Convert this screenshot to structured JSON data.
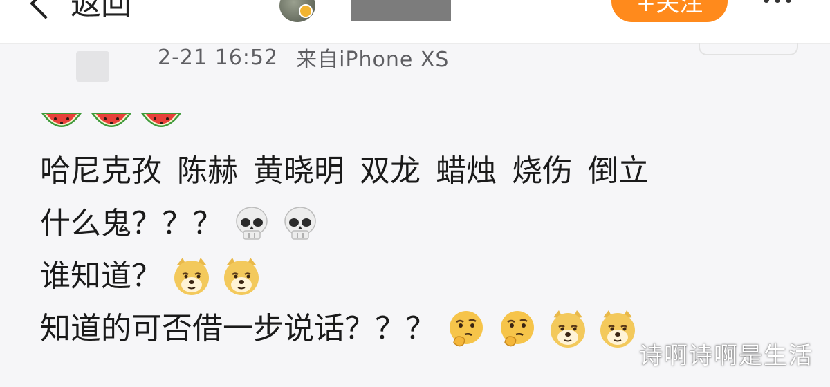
{
  "nav": {
    "back_label": "返回",
    "follow_label": "+关注"
  },
  "post": {
    "time": "2-21 16:52",
    "source": "来自iPhone XS",
    "lines": [
      {
        "words": [
          "哈尼克孜",
          "陈赫",
          "黄晓明",
          "双龙",
          "蜡烛",
          "烧伤",
          "倒立"
        ]
      },
      {
        "text": "什么鬼？？？"
      },
      {
        "text": "谁知道？"
      },
      {
        "text": "知道的可否借一步说话？？？"
      }
    ],
    "emojis": {
      "line0": [
        "watermelon-icon",
        "watermelon-icon",
        "watermelon-icon"
      ],
      "line2": [
        "skull-icon",
        "skull-icon"
      ],
      "line3": [
        "doge-icon",
        "doge-icon"
      ],
      "line4": [
        "thinking-face-icon",
        "thinking-face-icon",
        "doge-icon",
        "doge-icon"
      ]
    }
  },
  "watermark": "诗啊诗啊是生活",
  "colors": {
    "follow": "#ff8a1c",
    "meta_text": "#5e5e62",
    "background": "#f6f6f8"
  }
}
